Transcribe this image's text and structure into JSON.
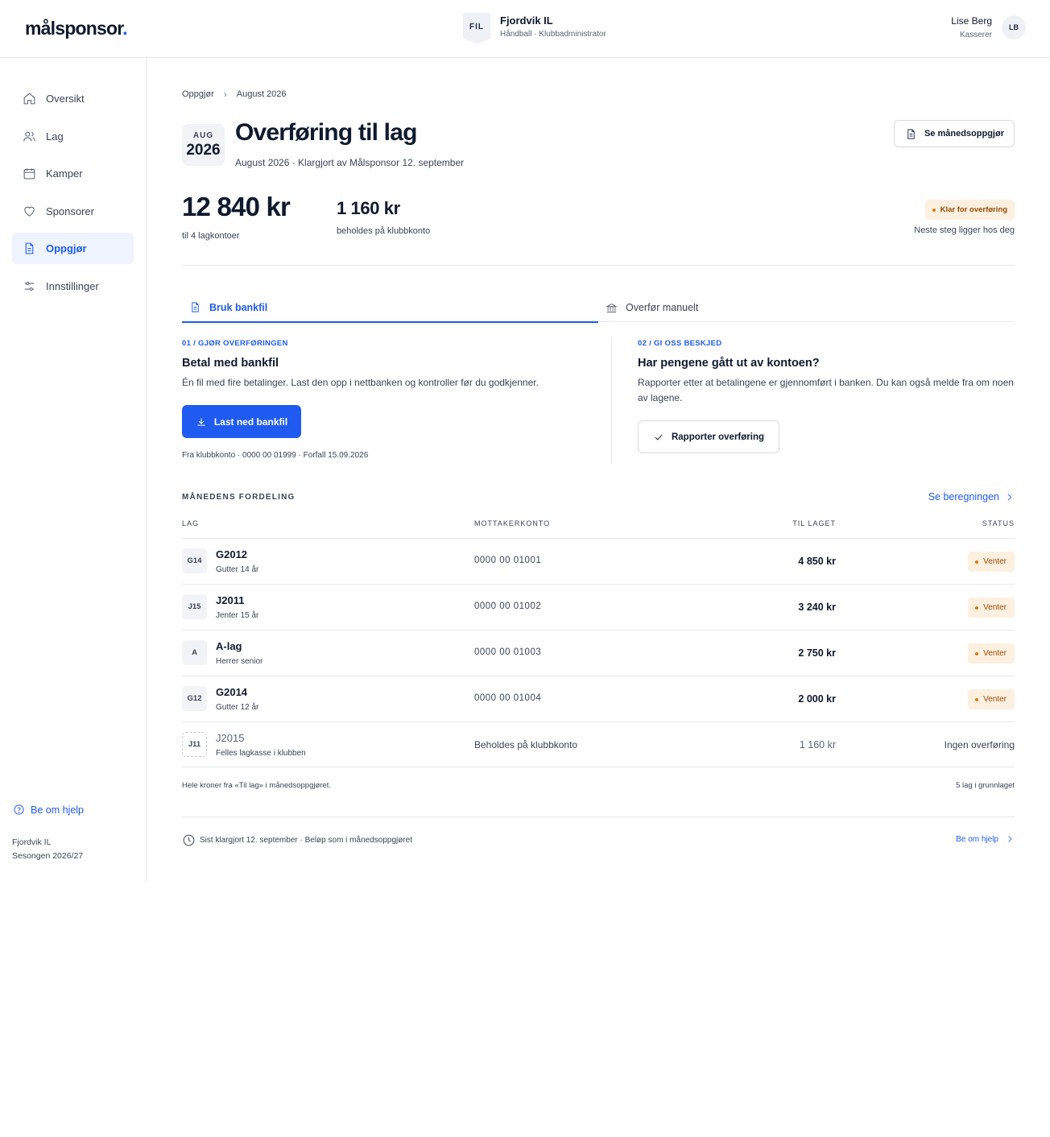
{
  "header": {
    "logo_text": "målsponsor",
    "logo_dot": ".",
    "club_badge": "FIL",
    "club_name": "Fjordvik IL",
    "club_sub": "Håndball · Klubbadministrator",
    "user_name": "Lise Berg",
    "user_role": "Kasserer",
    "user_initials": "LB"
  },
  "sidebar": {
    "items": [
      {
        "label": "Oversikt",
        "icon": "home-icon"
      },
      {
        "label": "Lag",
        "icon": "users-icon"
      },
      {
        "label": "Kamper",
        "icon": "calendar-icon"
      },
      {
        "label": "Sponsorer",
        "icon": "heart-icon"
      },
      {
        "label": "Oppgjør",
        "icon": "document-icon",
        "active": true
      },
      {
        "label": "Innstillinger",
        "icon": "sliders-icon"
      }
    ],
    "help": "Be om hjelp",
    "footer_club": "Fjordvik IL",
    "footer_season": "Sesongen 2026/27"
  },
  "breadcrumb": {
    "parent": "Oppgjør",
    "current": "August 2026"
  },
  "page": {
    "date_month": "AUG",
    "date_year": "2026",
    "title": "Overføring til lag",
    "subtitle": "August 2026 · Klargjort av Målsponsor 12. september",
    "monthly_button": "Se månedsoppgjør",
    "total_amount": "12 840 kr",
    "total_sub": "til 4 lagkontoer",
    "club_amount": "1 160 kr",
    "club_sub": "beholdes på klubbkonto",
    "status_badge": "Klar for overføring",
    "next_step": "Neste steg ligger hos deg"
  },
  "tabs": [
    {
      "label": "Bruk bankfil",
      "active": true
    },
    {
      "label": "Overfør manuelt",
      "active": false
    }
  ],
  "step1": {
    "label": "01 / GJØR OVERFØRINGEN",
    "title": "Betal med bankfil",
    "desc": "Én fil med fire betalinger. Last den opp i nettbanken og kontroller før du godkjenner.",
    "button": "Last ned bankfil",
    "from": "Fra klubbkonto · 0000 00 01999 · Forfall 15.09.2026"
  },
  "step2": {
    "label": "02 / GI OSS BESKJED",
    "title": "Har pengene gått ut av kontoen?",
    "desc": "Rapporter etter at betalingene er gjennomført i banken. Du kan også melde fra om noen av lagene.",
    "button": "Rapporter overføring"
  },
  "distribution": {
    "title": "MÅNEDENS FORDELING",
    "see_calc": "Se beregningen",
    "columns": {
      "team": "LAG",
      "account": "MOTTAKERKONTO",
      "amount": "TIL LAGET",
      "status": "STATUS"
    },
    "rows": [
      {
        "code": "G14",
        "team": "G2012",
        "sub": "Gutter 14 år",
        "account": "0000 00 01001",
        "amount": "4 850 kr",
        "status": "Venter"
      },
      {
        "code": "J15",
        "team": "J2011",
        "sub": "Jenter 15 år",
        "account": "0000 00 01002",
        "amount": "3 240 kr",
        "status": "Venter"
      },
      {
        "code": "A",
        "team": "A-lag",
        "sub": "Herrer senior",
        "account": "0000 00 01003",
        "amount": "2 750 kr",
        "status": "Venter"
      },
      {
        "code": "G12",
        "team": "G2014",
        "sub": "Gutter 12 år",
        "account": "0000 00 01004",
        "amount": "2 000 kr",
        "status": "Venter"
      },
      {
        "code": "J11",
        "team": "J2015",
        "sub": "Felles lagkasse i klubben",
        "account": "Beholdes på klubbkonto",
        "amount": "1 160 kr",
        "status": "Ingen overføring"
      }
    ],
    "foot_left": "Hele kroner fra «Til lag» i månedsoppgjøret.",
    "foot_right": "5 lag i grunnlaget"
  },
  "footer": {
    "last_prepared": "Sist klargjort 12. september · Beløp som i månedsoppgjøret",
    "help": "Be om hjelp"
  },
  "colors": {
    "accent": "#1f5bf0",
    "warning_bg": "#fdf0e0",
    "warning_text": "#9a4a05"
  }
}
